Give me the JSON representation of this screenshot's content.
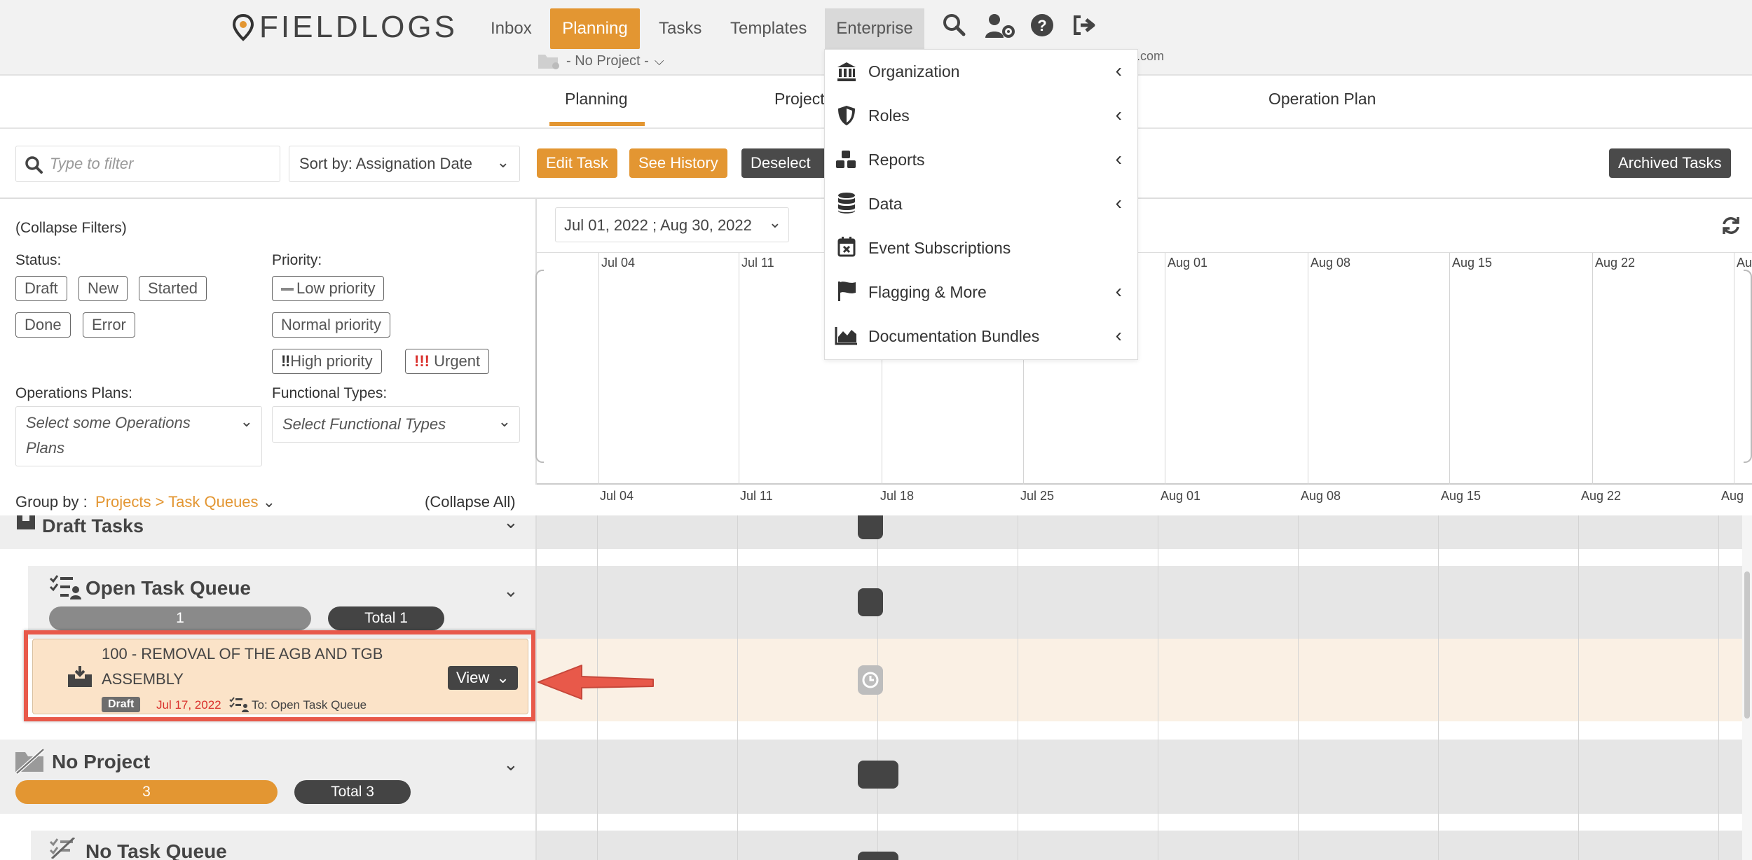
{
  "brand": {
    "name": "FIELDLOGS"
  },
  "nav": {
    "items": [
      "Inbox",
      "Planning",
      "Tasks",
      "Templates",
      "Enterprise"
    ],
    "project_selector": "- No Project -",
    "email_suffix": ".com"
  },
  "tabs": [
    "Planning",
    "Project",
    "Operation Plan"
  ],
  "toolbar": {
    "filter_placeholder": "Type to filter",
    "sort_label": "Sort by: Assignation Date",
    "edit_task": "Edit Task",
    "see_history": "See History",
    "deselect": "Deselect T",
    "archived": "Archived Tasks"
  },
  "filters": {
    "collapse": "(Collapse Filters)",
    "status_label": "Status:",
    "statuses": [
      "Draft",
      "New",
      "Started",
      "Done",
      "Error"
    ],
    "priority_label": "Priority:",
    "priorities": [
      "Low priority",
      "Normal priority",
      "High priority",
      "Urgent"
    ],
    "ops_label": "Operations Plans:",
    "ops_placeholder_1": "Select some Operations",
    "ops_placeholder_2": "Plans",
    "func_label": "Functional Types:",
    "func_placeholder": "Select Functional Types"
  },
  "gantt": {
    "date_range": "Jul 01, 2022 ; Aug 30, 2022",
    "top_dates": [
      "Jul 04",
      "Jul 11",
      "Aug 01",
      "Aug 08",
      "Aug 15",
      "Aug 22",
      "Au"
    ],
    "bottom_dates": [
      "Jul 04",
      "Jul 11",
      "Jul 18",
      "Jul 25",
      "Aug 01",
      "Aug 08",
      "Aug 15",
      "Aug 22",
      "Aug"
    ]
  },
  "groupby": {
    "label": "Group by :",
    "value": "Projects > Task Queues",
    "collapse_all": "(Collapse All)"
  },
  "list": {
    "draft_tasks": "Draft Tasks",
    "open_queue": "Open Task Queue",
    "open_count": "1",
    "open_total": "Total 1",
    "task_title_1": "100 - REMOVAL OF THE AGB AND TGB",
    "task_title_2": "ASSEMBLY",
    "task_status": "Draft",
    "task_date": "Jul 17, 2022",
    "task_queue": "To: Open Task Queue",
    "view_btn": "View",
    "no_project": "No Project",
    "np_count": "3",
    "np_total": "Total 3",
    "no_queue": "No Task Queue"
  },
  "dropdown": {
    "items": [
      {
        "label": "Organization",
        "icon": "bank-icon",
        "sub": true
      },
      {
        "label": "Roles",
        "icon": "shield-icon",
        "sub": true
      },
      {
        "label": "Reports",
        "icon": "cubes-icon",
        "sub": true
      },
      {
        "label": "Data",
        "icon": "database-icon",
        "sub": true
      },
      {
        "label": "Event Subscriptions",
        "icon": "calendar-x-icon",
        "sub": false
      },
      {
        "label": "Flagging & More",
        "icon": "flag-icon",
        "sub": true
      },
      {
        "label": "Documentation Bundles",
        "icon": "area-chart-icon",
        "sub": true
      }
    ]
  },
  "colors": {
    "accent": "#e39632",
    "dark": "#4a4a4a",
    "highlight": "#e8594a"
  }
}
